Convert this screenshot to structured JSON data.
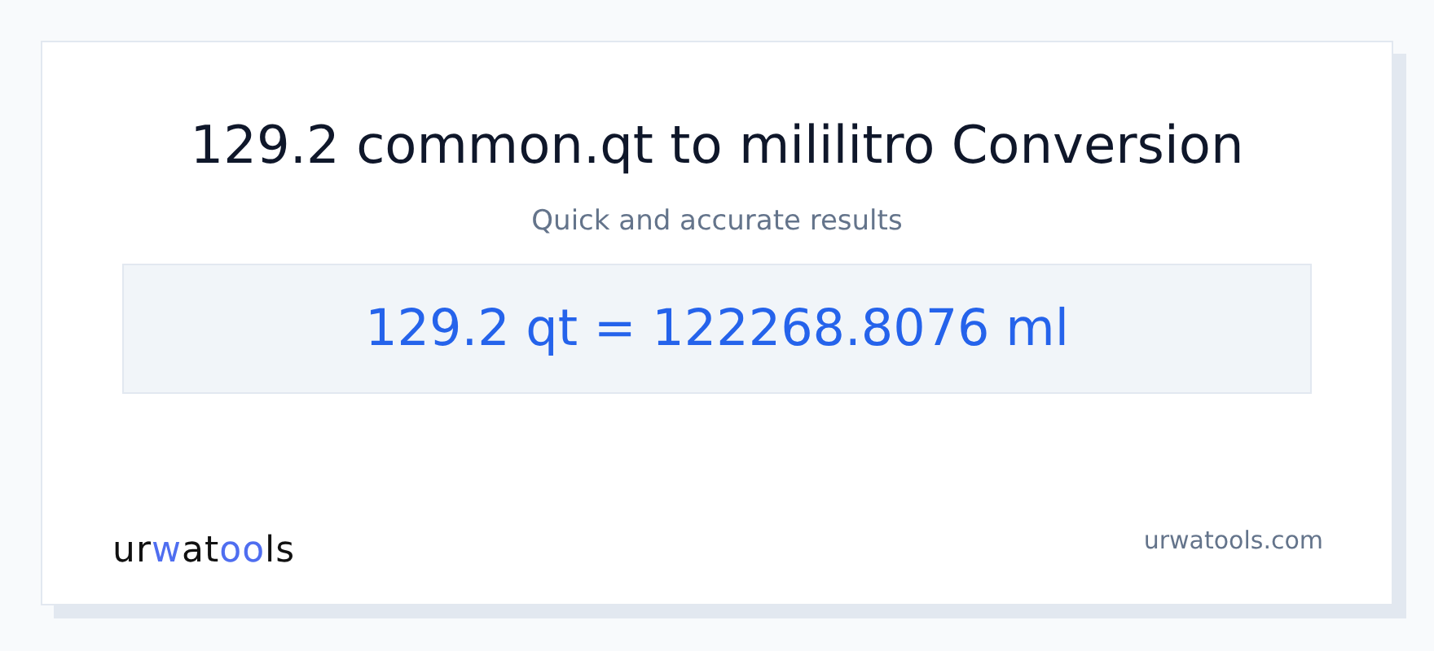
{
  "title": "129.2 common.qt to mililitro Conversion",
  "subtitle": "Quick and accurate results",
  "result": "129.2 qt = 122268.8076 ml",
  "logo": {
    "parts": [
      {
        "text": "ur",
        "accent": false
      },
      {
        "text": "w",
        "accent": true
      },
      {
        "text": "at",
        "accent": false
      },
      {
        "text": "oo",
        "accent": true
      },
      {
        "text": "ls",
        "accent": false
      }
    ]
  },
  "site": "urwatools.com"
}
